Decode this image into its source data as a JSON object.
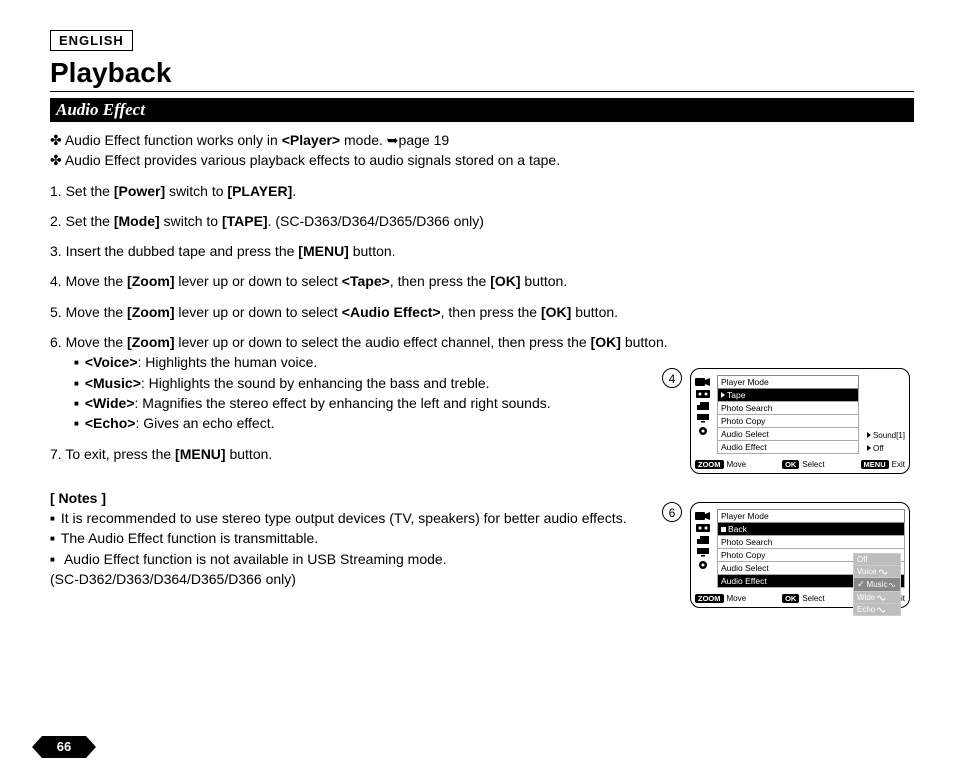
{
  "lang": "ENGLISH",
  "title": "Playback",
  "section": "Audio Effect",
  "intro1_pre": "✤  Audio Effect function works only in ",
  "intro1_bold": "<Player>",
  "intro1_post": " mode. ➥page 19",
  "intro2": "✤  Audio Effect provides various playback effects to audio signals stored on a tape.",
  "s1_a": "1.  Set the ",
  "s1_b": "[Power]",
  "s1_c": " switch to ",
  "s1_d": "[PLAYER]",
  "s1_e": ".",
  "s2_a": "2.  Set the ",
  "s2_b": "[Mode]",
  "s2_c": " switch to ",
  "s2_d": "[TAPE]",
  "s2_e": ". (SC-D363/D364/D365/D366 only)",
  "s3_a": "3.  Insert the dubbed tape and press the ",
  "s3_b": "[MENU]",
  "s3_c": " button.",
  "s4_a": "4.  Move the ",
  "s4_b": "[Zoom]",
  "s4_c": " lever up or down to select ",
  "s4_d": "<Tape>",
  "s4_e": ", then press the ",
  "s4_f": "[OK]",
  "s4_g": " button.",
  "s5_a": "5.  Move the ",
  "s5_b": "[Zoom]",
  "s5_c": " lever up or down to select ",
  "s5_d": "<Audio Effect>",
  "s5_e": ", then press the ",
  "s5_f": "[OK]",
  "s5_g": " button.",
  "s6_a": "6.  Move the ",
  "s6_b": "[Zoom]",
  "s6_c": " lever up or down to select the audio effect channel, then press the ",
  "s6_d": "[OK]",
  "s6_e": " button.",
  "eff1_b": "<Voice>",
  "eff1_t": ": Highlights the human voice.",
  "eff2_b": "<Music>",
  "eff2_t": ": Highlights the sound by enhancing the bass and treble.",
  "eff3_b": "<Wide>",
  "eff3_t": ": Magnifies the stereo effect by enhancing the left and right sounds.",
  "eff4_b": "<Echo>",
  "eff4_t": ": Gives an echo effect.",
  "s7_a": "7.  To exit, press the ",
  "s7_b": "[MENU]",
  "s7_c": " button.",
  "notes_title": "[ Notes ]",
  "n1": "It is recommended to use stereo type output devices (TV, speakers) for better audio effects.",
  "n2": "The Audio Effect function is transmittable.",
  "n3a": "Audio Effect function is not available in USB Streaming mode.",
  "n3b": "(SC-D362/D363/D364/D365/D366 only)",
  "page": "66",
  "lcd": {
    "header": "Player Mode",
    "tape": "Tape",
    "back": "Back",
    "items": [
      "Photo Search",
      "Photo Copy",
      "Audio Select",
      "Audio Effect"
    ],
    "side4": {
      "audioSelect": "Sound[1]",
      "audioEffect": "Off"
    },
    "opts": [
      "Off",
      "Voice",
      "Music",
      "Wide",
      "Echo"
    ],
    "footer": {
      "zoom": "ZOOM",
      "move": "Move",
      "ok": "OK",
      "select": "Select",
      "menu": "MENU",
      "exit": "Exit"
    }
  },
  "stepnum4": "4",
  "stepnum6": "6"
}
